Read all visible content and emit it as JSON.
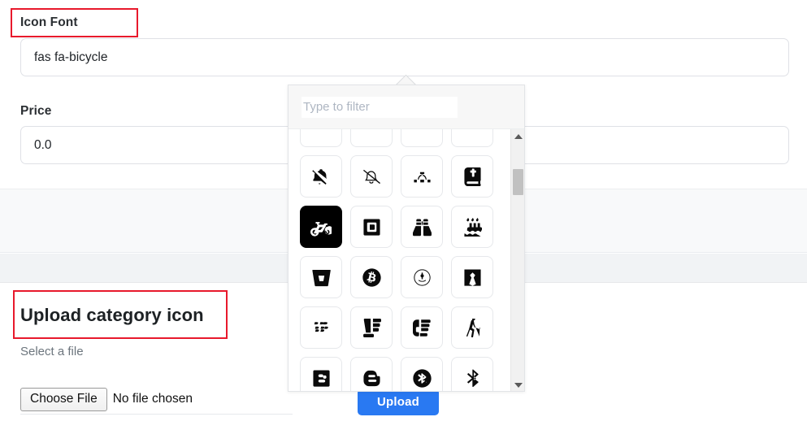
{
  "form": {
    "icon_font": {
      "label": "Icon Font",
      "value": "fas fa-bicycle",
      "placeholder": ""
    },
    "price": {
      "label": "Price",
      "value": "0.0",
      "placeholder": ""
    },
    "upload": {
      "heading": "Upload category icon",
      "select_file_label": "Select a file",
      "choose_file_button": "Choose File",
      "no_file_text": "No file chosen",
      "upload_button": "Upload"
    }
  },
  "picker": {
    "filter_placeholder": "Type to filter",
    "selected_icon": "bicycle",
    "icons": [
      {
        "name": "bell-slash",
        "selected": false
      },
      {
        "name": "bell-slash-outline",
        "selected": false
      },
      {
        "name": "bezier-curve",
        "selected": false
      },
      {
        "name": "bible",
        "selected": false
      },
      {
        "name": "bicycle",
        "selected": true
      },
      {
        "name": "bimobject",
        "selected": false
      },
      {
        "name": "binoculars",
        "selected": false
      },
      {
        "name": "birthday-cake",
        "selected": false
      },
      {
        "name": "bitbucket",
        "selected": false
      },
      {
        "name": "bitcoin",
        "selected": false
      },
      {
        "name": "bity",
        "selected": false
      },
      {
        "name": "black-tie",
        "selected": false
      },
      {
        "name": "blackberry",
        "selected": false
      },
      {
        "name": "blender",
        "selected": false
      },
      {
        "name": "blender-phone",
        "selected": false
      },
      {
        "name": "blind",
        "selected": false
      },
      {
        "name": "blogger-b",
        "selected": false
      },
      {
        "name": "blogger",
        "selected": false
      },
      {
        "name": "bluetooth",
        "selected": false
      },
      {
        "name": "bluetooth-b",
        "selected": false
      }
    ]
  },
  "colors": {
    "accent": "#2979f2",
    "highlight_box": "#e8192c",
    "selected_tile_bg": "#000000",
    "band_light": "#f8f9fa",
    "band_dark": "#f1f3f5"
  }
}
